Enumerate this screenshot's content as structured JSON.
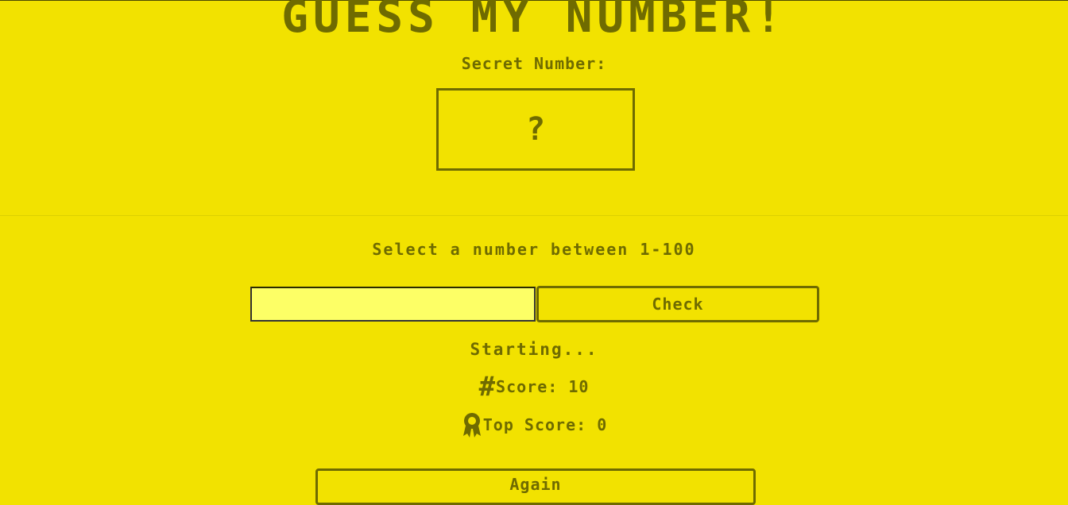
{
  "title": "GUESS MY NUMBER!",
  "secret": {
    "label": "Secret Number:",
    "value": "?"
  },
  "instruction": "Select a number between 1-100",
  "guess_input": {
    "value": "",
    "placeholder": ""
  },
  "check_label": "Check",
  "message": "Starting...",
  "score": {
    "icon": "hash-icon",
    "label": "Score: 10"
  },
  "top_score": {
    "icon": "medal-icon",
    "label": "Top Score: 0"
  },
  "again_label": "Again",
  "colors": {
    "background": "#f2e200",
    "text": "#6f6b00",
    "input_bg": "#fdff66"
  }
}
